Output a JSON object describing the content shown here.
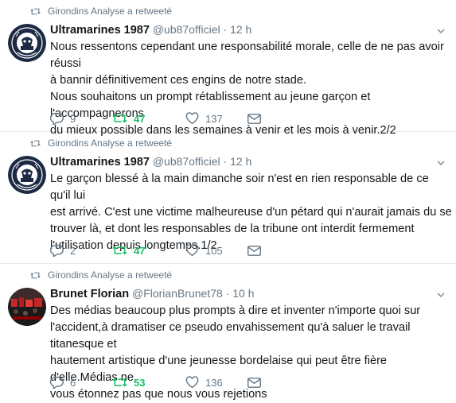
{
  "colors": {
    "retweet_active": "#17bf63",
    "secondary_text": "#657786",
    "primary_text": "#14171a"
  },
  "tweets": [
    {
      "retweeted_by": "Girondins Analyse a retweeté",
      "name": "Ultramarines 1987",
      "handle": "@ub87officiel",
      "dot": "·",
      "time": "12 h",
      "text_lines": [
        "Nous ressentons cependant une responsabilité morale, celle de ne pas avoir réussi",
        "à bannir définitivement ces engins de notre stade.",
        "Nous souhaitons un prompt rétablissement au jeune garçon et l'accompagnerons",
        "du mieux possible dans les semaines à venir et les mois à venir.2/2"
      ],
      "replies": "9",
      "retweets": "47",
      "likes": "137",
      "avatar_icon": "virage-sud-logo"
    },
    {
      "retweeted_by": "Girondins Analyse a retweeté",
      "name": "Ultramarines 1987",
      "handle": "@ub87officiel",
      "dot": "·",
      "time": "12 h",
      "text_lines": [
        "Le garçon blessé à la main dimanche soir n'est en rien responsable de ce qu'il lui",
        "est arrivé. C'est une victime malheureuse d'un pétard qui n'aurait jamais du se",
        "trouver là, et dont les responsables de la tribune ont interdit fermement",
        "l'utilisation depuis longtemps.1/2"
      ],
      "replies": "2",
      "retweets": "47",
      "likes": "105",
      "avatar_icon": "virage-sud-logo"
    },
    {
      "retweeted_by": "Girondins Analyse a retweeté",
      "name": "Brunet Florian",
      "handle": "@FlorianBrunet78",
      "dot": "·",
      "time": "10 h",
      "text_lines": [
        "Des médias beaucoup plus prompts à dire et inventer n'importe quoi sur",
        "l'accident,à dramatiser ce pseudo envahissement qu'à saluer le travail titanesque et",
        "hautement artistique d'une jeunesse bordelaise qui peut être fière d'elle.Médias ne",
        "vous étonnez pas que nous vous rejetions"
      ],
      "replies": "6",
      "retweets": "53",
      "likes": "136",
      "avatar_icon": "crowd-photo"
    }
  ]
}
